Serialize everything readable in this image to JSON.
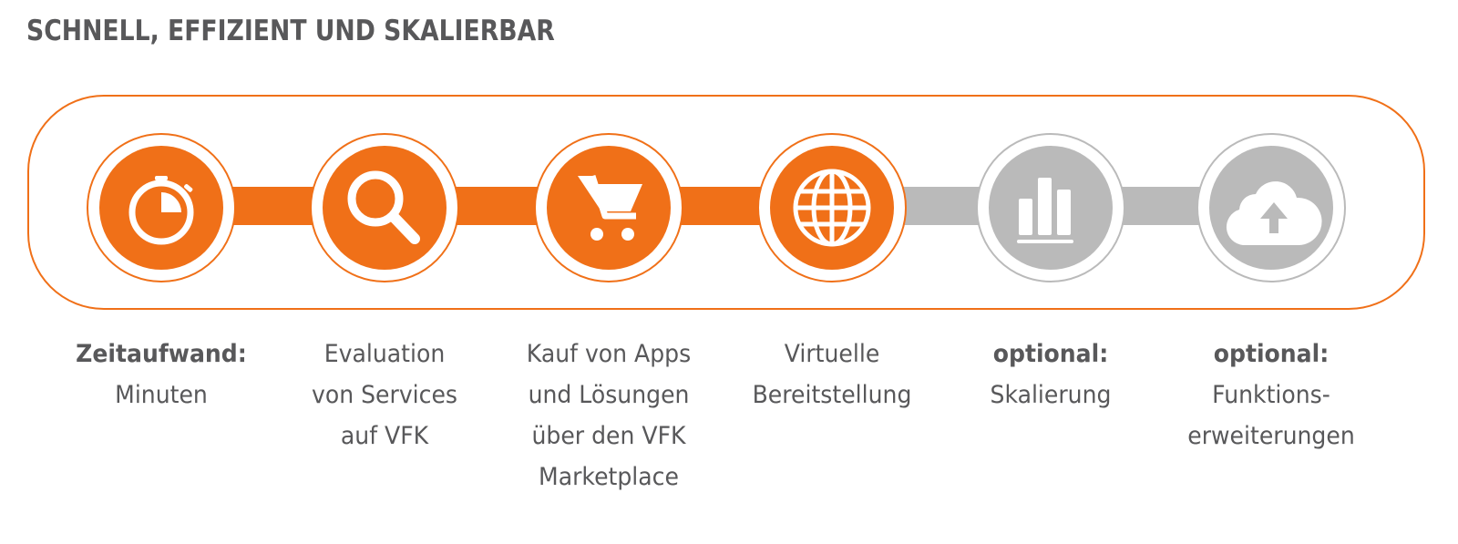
{
  "title": "SCHNELL, EFFIZIENT UND SKALIERBAR",
  "colors": {
    "active": "#f07018",
    "inactive": "#bababa",
    "text": "#58585a",
    "frame": "#f07018"
  },
  "steps": [
    {
      "icon": "stopwatch-icon",
      "status": "active",
      "bold": "Zeitaufwand:",
      "lines": [
        "Minuten"
      ]
    },
    {
      "icon": "magnifier-icon",
      "status": "active",
      "bold": "",
      "lines": [
        "Evaluation",
        "von Services",
        "auf VFK"
      ]
    },
    {
      "icon": "shopping-cart-icon",
      "status": "active",
      "bold": "",
      "lines": [
        "Kauf von Apps",
        "und Lösungen",
        "über den VFK",
        "Marketplace"
      ]
    },
    {
      "icon": "globe-icon",
      "status": "active",
      "bold": "",
      "lines": [
        "Virtuelle",
        "Bereitstellung"
      ]
    },
    {
      "icon": "bar-chart-icon",
      "status": "optional",
      "bold": "optional:",
      "lines": [
        "Skalierung"
      ]
    },
    {
      "icon": "cloud-upload-icon",
      "status": "optional",
      "bold": "optional:",
      "lines": [
        "Funktions-",
        "erweiterungen"
      ]
    }
  ]
}
